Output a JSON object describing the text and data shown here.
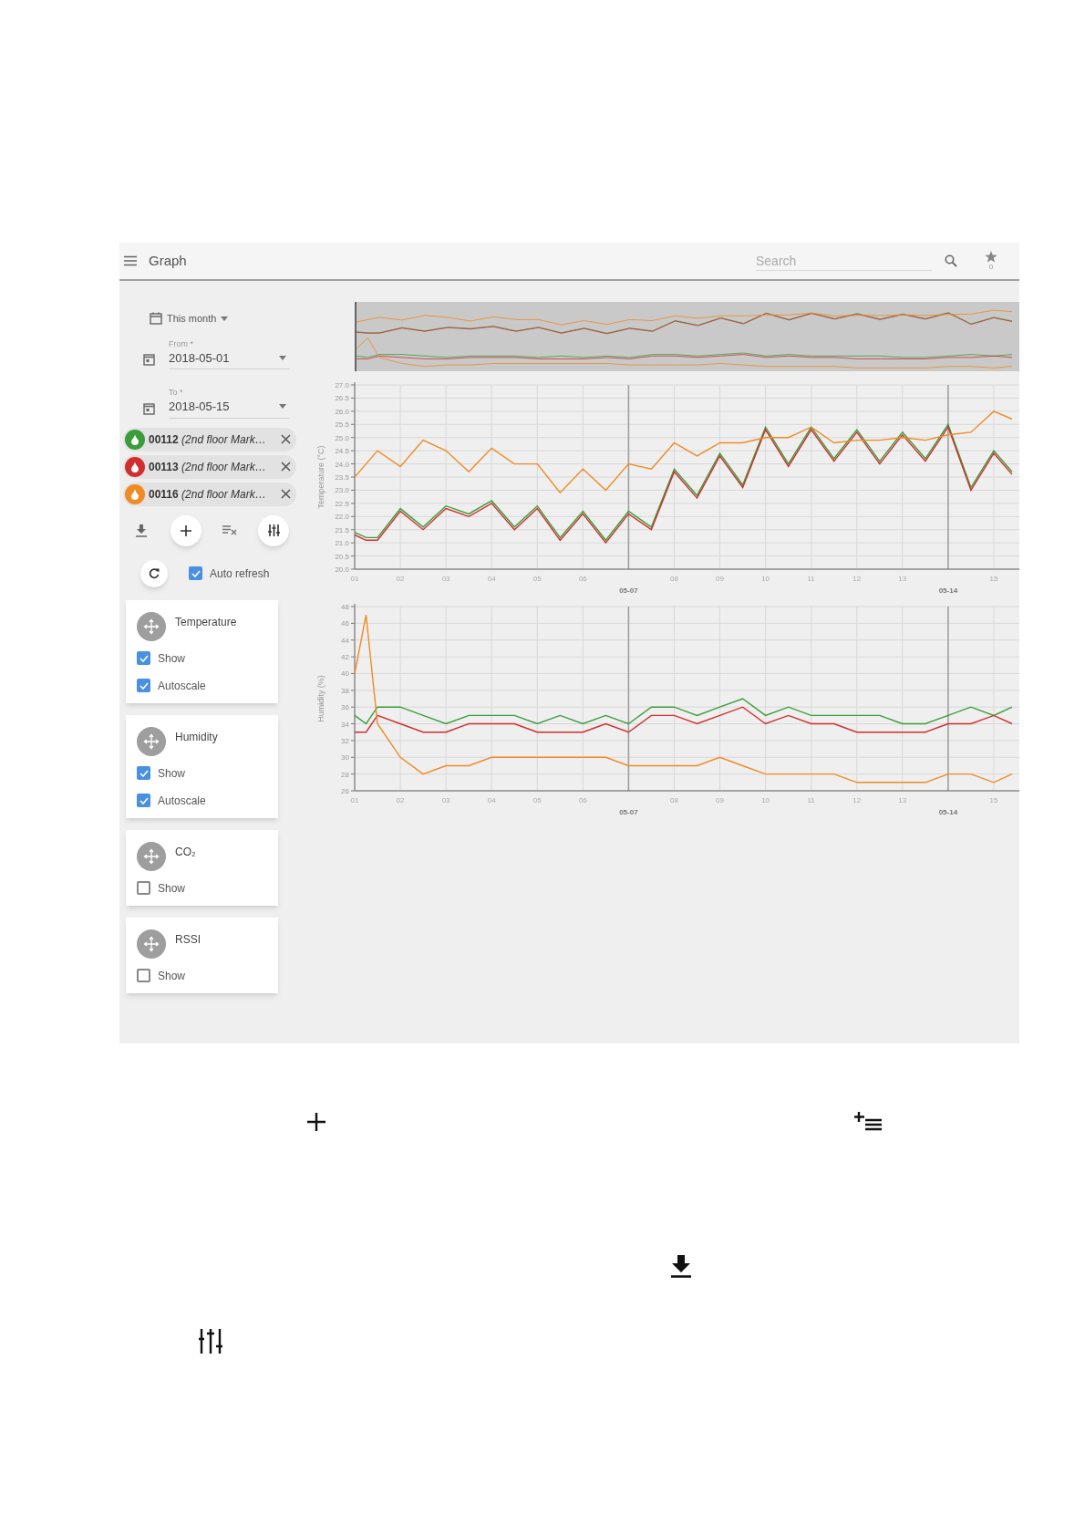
{
  "header": {
    "title": "Graph",
    "search": {
      "placeholder": "Search"
    },
    "favorites_count": "0"
  },
  "period": {
    "preset": "This month",
    "from": {
      "label": "From *",
      "value": "2018-05-01"
    },
    "to": {
      "label": "To *",
      "value": "2018-05-15"
    }
  },
  "sensors": [
    {
      "label": "**00112** *(2nd floor Mark…*",
      "color": "#3a9d3a"
    },
    {
      "label": "**00113** *(2nd floor Mark…*",
      "color": "#d12e2e"
    },
    {
      "label": "**00116** *(2nd floor Mark…*",
      "color": "#f08a24"
    }
  ],
  "auto_refresh": {
    "label": "Auto refresh",
    "checked": true
  },
  "quantities": [
    {
      "title": "Temperature",
      "options": [
        {
          "label": "Show",
          "checked": true
        },
        {
          "label": "Autoscale",
          "checked": true
        }
      ]
    },
    {
      "title": "Humidity",
      "options": [
        {
          "label": "Show",
          "checked": true
        },
        {
          "label": "Autoscale",
          "checked": true
        }
      ]
    },
    {
      "title": "CO₂",
      "options": [
        {
          "label": "Show",
          "checked": false
        }
      ]
    },
    {
      "title": "RSSI",
      "options": [
        {
          "label": "Show",
          "checked": false
        }
      ]
    }
  ],
  "charts": [
    {
      "chart_data": {
        "type": "line",
        "ylabel": "Temperature (°C)",
        "x": [
          1,
          1.25,
          1.5,
          2,
          2.5,
          3,
          3.5,
          4,
          4.5,
          5,
          5.5,
          6,
          6.5,
          7,
          7.5,
          8,
          8.5,
          9,
          9.5,
          10,
          10.5,
          11,
          11.5,
          12,
          12.5,
          13,
          13.5,
          14,
          14.5,
          15,
          15.4
        ],
        "xlim": [
          1,
          15.56
        ],
        "ylim": [
          20,
          27
        ],
        "grid": true,
        "ref_lines": [
          {
            "axis": "x",
            "value": 7
          },
          {
            "axis": "x",
            "value": 14
          }
        ],
        "annotations": [
          "05-07",
          "05-14"
        ],
        "xticks": [
          {
            "value": 1,
            "label": "01"
          },
          {
            "value": 2,
            "label": "02"
          },
          {
            "value": 3,
            "label": "03"
          },
          {
            "value": 4,
            "label": "04"
          },
          {
            "value": 5,
            "label": "05"
          },
          {
            "value": 6,
            "label": "06"
          },
          {
            "value": 8,
            "label": "08"
          },
          {
            "value": 9,
            "label": "09"
          },
          {
            "value": 10,
            "label": "10"
          },
          {
            "value": 11,
            "label": "11"
          },
          {
            "value": 12,
            "label": "12"
          },
          {
            "value": 13,
            "label": "13"
          },
          {
            "value": 15,
            "label": "15"
          }
        ],
        "yticks": [
          {
            "value": 20,
            "label": "20.0"
          },
          {
            "value": 20.5,
            "label": "20.5"
          },
          {
            "value": 21,
            "label": "21.0"
          },
          {
            "value": 21.5,
            "label": "21.5"
          },
          {
            "value": 22,
            "label": "22.0"
          },
          {
            "value": 22.5,
            "label": "22.5"
          },
          {
            "value": 23,
            "label": "23.0"
          },
          {
            "value": 23.5,
            "label": "23.5"
          },
          {
            "value": 24,
            "label": "24.0"
          },
          {
            "value": 24.5,
            "label": "24.5"
          },
          {
            "value": 25,
            "label": "25.0"
          },
          {
            "value": 25.5,
            "label": "25.5"
          },
          {
            "value": 26,
            "label": "26.0"
          },
          {
            "value": 26.5,
            "label": "26.5"
          },
          {
            "value": 27,
            "label": "27.0"
          }
        ],
        "series": [
          {
            "color": "#3a9d3a",
            "values": [
              21.4,
              21.2,
              21.2,
              22.3,
              21.6,
              22.4,
              22.1,
              22.6,
              21.6,
              22.4,
              21.2,
              22.2,
              21.1,
              22.2,
              21.6,
              23.8,
              22.8,
              24.4,
              23.2,
              25.4,
              24.0,
              25.4,
              24.2,
              25.3,
              24.1,
              25.2,
              24.2,
              25.5,
              23.1,
              24.5,
              23.7
            ]
          },
          {
            "color": "#d12e2e",
            "values": [
              21.3,
              21.1,
              21.1,
              22.2,
              21.5,
              22.3,
              22.0,
              22.5,
              21.5,
              22.3,
              21.1,
              22.1,
              21.0,
              22.1,
              21.5,
              23.7,
              22.7,
              24.3,
              23.1,
              25.3,
              23.9,
              25.3,
              24.1,
              25.2,
              24.0,
              25.1,
              24.1,
              25.4,
              23.0,
              24.4,
              23.6
            ]
          },
          {
            "color": "#f08a24",
            "values": [
              23.5,
              24.0,
              24.5,
              23.9,
              24.9,
              24.5,
              23.7,
              24.6,
              24.0,
              24.0,
              22.9,
              23.8,
              23.0,
              24.0,
              23.8,
              24.8,
              24.3,
              24.8,
              24.8,
              25.0,
              25.0,
              25.4,
              24.8,
              24.9,
              24.9,
              25.0,
              24.9,
              25.1,
              25.2,
              26.0,
              25.7
            ]
          }
        ]
      }
    },
    {
      "chart_data": {
        "type": "line",
        "ylabel": "Humidity (%)",
        "x": [
          1,
          1.25,
          1.5,
          2,
          2.5,
          3,
          3.5,
          4,
          4.5,
          5,
          5.5,
          6,
          6.5,
          7,
          7.5,
          8,
          8.5,
          9,
          9.5,
          10,
          10.5,
          11,
          11.5,
          12,
          12.5,
          13,
          13.5,
          14,
          14.5,
          15,
          15.4
        ],
        "xlim": [
          1,
          15.56
        ],
        "ylim": [
          26,
          48
        ],
        "grid": true,
        "ref_lines": [
          {
            "axis": "x",
            "value": 7
          },
          {
            "axis": "x",
            "value": 14
          }
        ],
        "annotations": [
          "05-07",
          "05-14"
        ],
        "xticks": [
          {
            "value": 1,
            "label": "01"
          },
          {
            "value": 2,
            "label": "02"
          },
          {
            "value": 3,
            "label": "03"
          },
          {
            "value": 4,
            "label": "04"
          },
          {
            "value": 5,
            "label": "05"
          },
          {
            "value": 6,
            "label": "06"
          },
          {
            "value": 8,
            "label": "08"
          },
          {
            "value": 9,
            "label": "09"
          },
          {
            "value": 10,
            "label": "10"
          },
          {
            "value": 11,
            "label": "11"
          },
          {
            "value": 12,
            "label": "12"
          },
          {
            "value": 13,
            "label": "13"
          },
          {
            "value": 15,
            "label": "15"
          }
        ],
        "yticks": [
          26,
          28,
          30,
          32,
          34,
          36,
          38,
          40,
          42,
          44,
          46,
          48
        ],
        "series": [
          {
            "color": "#3a9d3a",
            "values": [
              35,
              34,
              36,
              36,
              35,
              34,
              35,
              35,
              35,
              34,
              35,
              34,
              35,
              34,
              36,
              36,
              35,
              36,
              37,
              35,
              36,
              35,
              35,
              35,
              35,
              34,
              34,
              35,
              36,
              35,
              36
            ]
          },
          {
            "color": "#d12e2e",
            "values": [
              33,
              33,
              35,
              34,
              33,
              33,
              34,
              34,
              34,
              33,
              33,
              33,
              34,
              33,
              35,
              35,
              34,
              35,
              36,
              34,
              35,
              34,
              34,
              33,
              33,
              33,
              33,
              34,
              34,
              35,
              34
            ]
          },
          {
            "color": "#f08a24",
            "values": [
              40,
              47,
              34,
              30,
              28,
              29,
              29,
              30,
              30,
              30,
              30,
              30,
              30,
              29,
              29,
              29,
              29,
              30,
              29,
              28,
              28,
              28,
              28,
              27,
              27,
              27,
              27,
              28,
              28,
              27,
              28
            ]
          }
        ]
      }
    }
  ]
}
